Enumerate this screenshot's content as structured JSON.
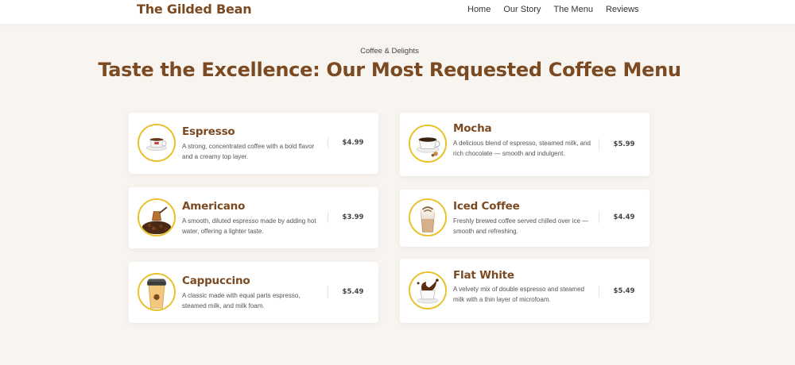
{
  "header": {
    "brand": "The Gilded Bean",
    "nav": [
      "Home",
      "Our Story",
      "The Menu",
      "Reviews"
    ]
  },
  "hero": {
    "eyebrow": "Coffee & Delights",
    "title": "Taste the Excellence: Our Most Requested Coffee Menu"
  },
  "menu": {
    "items": [
      {
        "name": "Espresso",
        "description": "A strong, concentrated coffee with a bold flavor and a creamy top layer.",
        "price": "$4.99",
        "icon": "espresso-cup-icon"
      },
      {
        "name": "Mocha",
        "description": "A delicious blend of espresso, steamed milk, and rich chocolate — smooth and indulgent.",
        "price": "$5.99",
        "icon": "mocha-cup-icon"
      },
      {
        "name": "Americano",
        "description": "A smooth, diluted espresso made by adding hot water, offering a lighter taste.",
        "price": "$3.99",
        "icon": "coffee-pot-beans-icon"
      },
      {
        "name": "Iced Coffee",
        "description": "Freshly brewed coffee served chilled over ice — smooth and refreshing.",
        "price": "$4.49",
        "icon": "iced-coffee-glass-icon"
      },
      {
        "name": "Cappuccino",
        "description": "A classic made with equal parts espresso, steamed milk, and milk foam.",
        "price": "$5.49",
        "icon": "takeaway-cup-icon"
      },
      {
        "name": "Flat White",
        "description": "A velvety mix of double espresso and steamed milk with a thin layer of microfoam.",
        "price": "$5.49",
        "icon": "splash-cup-icon"
      }
    ]
  },
  "colors": {
    "page_background": "#f8f4f0",
    "brand_brown": "#7b4a22",
    "thumb_ring": "#e8c22a",
    "card_background": "#ffffff"
  }
}
